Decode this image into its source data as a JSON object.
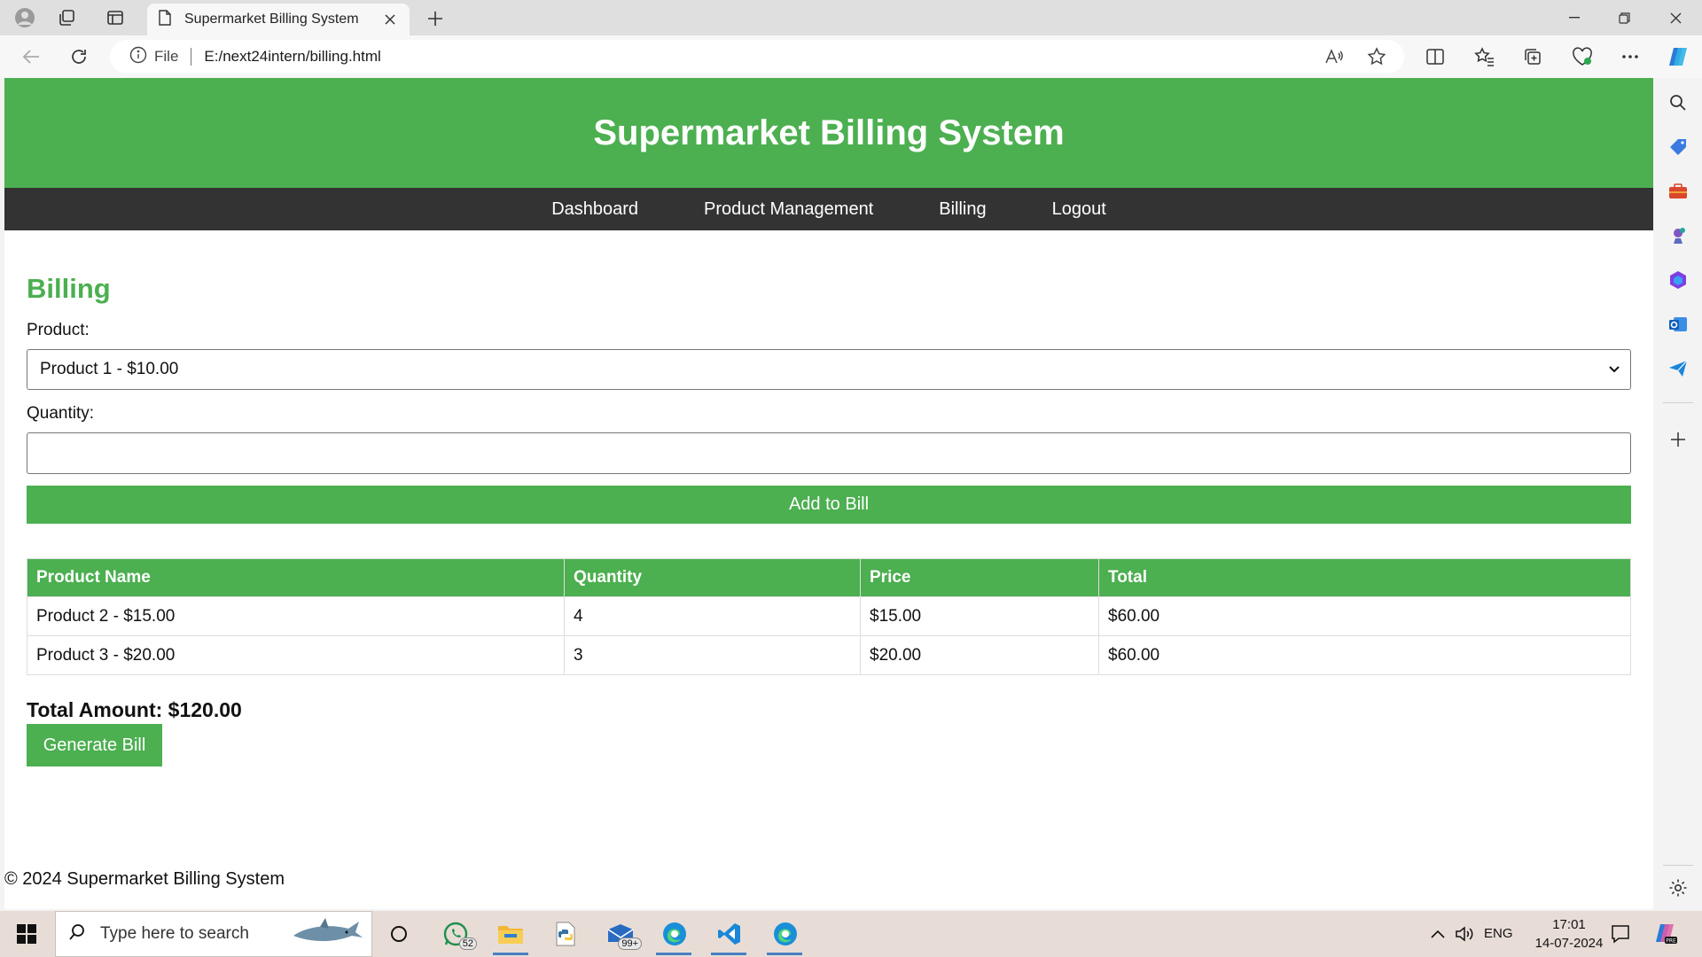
{
  "browser": {
    "tab_title": "Supermarket Billing System",
    "url_scheme_label": "File",
    "url": "E:/next24intern/billing.html"
  },
  "page": {
    "site_title": "Supermarket Billing System",
    "nav": [
      {
        "label": "Dashboard"
      },
      {
        "label": "Product Management"
      },
      {
        "label": "Billing"
      },
      {
        "label": "Logout"
      }
    ],
    "section_title": "Billing",
    "product_label": "Product:",
    "product_selected": "Product 1 - $10.00",
    "quantity_label": "Quantity:",
    "quantity_value": "",
    "add_button": "Add to Bill",
    "table": {
      "headers": [
        "Product Name",
        "Quantity",
        "Price",
        "Total"
      ],
      "rows": [
        [
          "Product 2 - $15.00",
          "4",
          "$15.00",
          "$60.00"
        ],
        [
          "Product 3 - $20.00",
          "3",
          "$20.00",
          "$60.00"
        ]
      ]
    },
    "total_amount": "Total Amount: $120.00",
    "generate_button": "Generate Bill",
    "footer": "© 2024 Supermarket Billing System"
  },
  "taskbar": {
    "search_placeholder": "Type here to search",
    "whatsapp_badge": "52",
    "mail_badge": "99+",
    "language": "ENG",
    "time": "17:01",
    "date": "14-07-2024"
  },
  "colors": {
    "accent_green": "#4caf50",
    "nav_dark": "#333333"
  }
}
